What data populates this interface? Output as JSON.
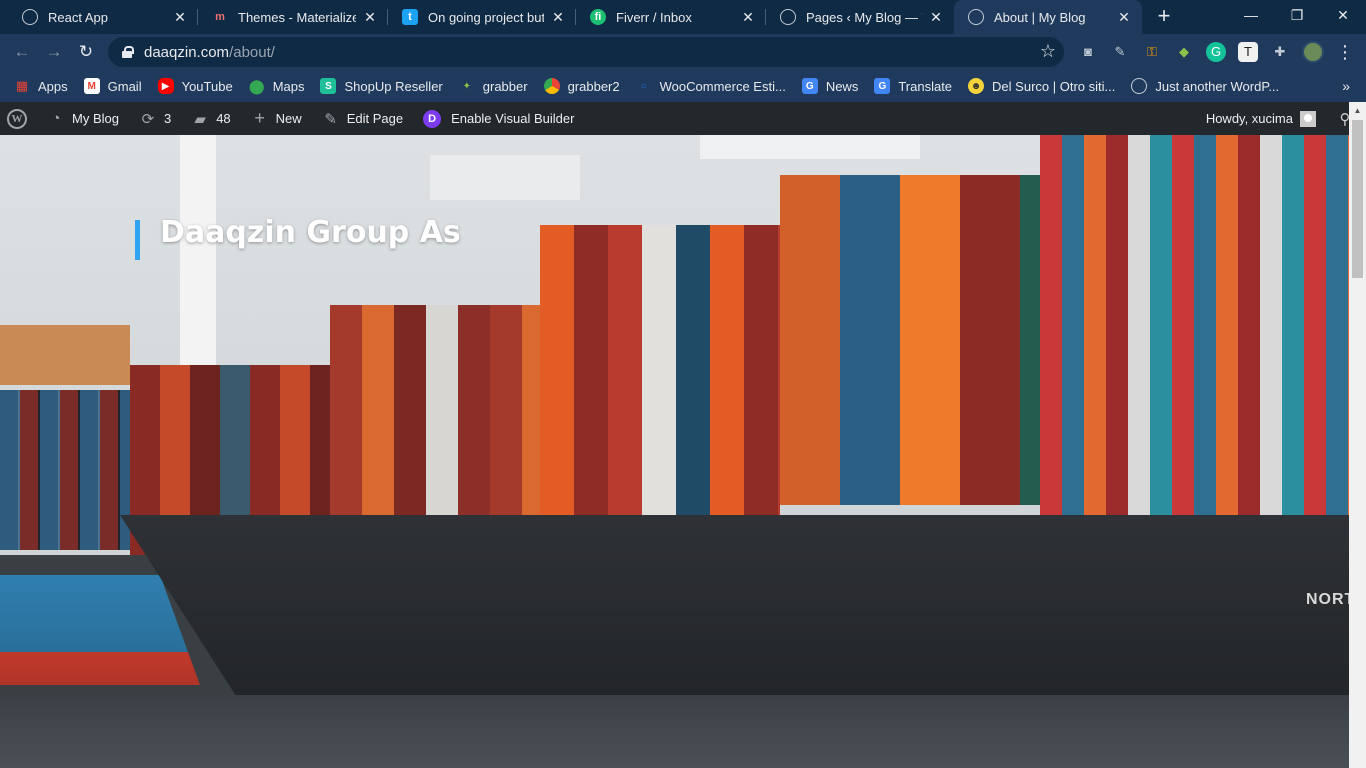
{
  "browser": {
    "tabs": [
      {
        "title": "React App",
        "favicon": "globe-icon",
        "active": false
      },
      {
        "title": "Themes - Materialize",
        "favicon": "materialize-icon",
        "active": false
      },
      {
        "title": "On going project but bu",
        "favicon": "twitter-icon",
        "active": false
      },
      {
        "title": "Fiverr / Inbox",
        "favicon": "fiverr-icon",
        "active": false
      },
      {
        "title": "Pages ‹ My Blog — Wor",
        "favicon": "globe-icon",
        "active": false
      },
      {
        "title": "About | My Blog",
        "favicon": "globe-icon",
        "active": true
      }
    ],
    "new_tab": "+",
    "window_controls": {
      "minimize": "—",
      "restore": "❐",
      "close": "✕"
    },
    "url_host": "daaqzin.com",
    "url_path": "/about/",
    "bookmarks": [
      {
        "label": "Apps",
        "icon": "apps-grid-icon",
        "color": "#ea4335"
      },
      {
        "label": "Gmail",
        "icon": "gmail-icon",
        "color": "#ea4335"
      },
      {
        "label": "YouTube",
        "icon": "youtube-icon",
        "color": "#ff0000"
      },
      {
        "label": "Maps",
        "icon": "maps-icon",
        "color": "#34a853"
      },
      {
        "label": "ShopUp Reseller",
        "icon": "shopup-icon",
        "color": "#1fbf9a"
      },
      {
        "label": "grabber",
        "icon": "grabber-icon",
        "color": "#8bc34a"
      },
      {
        "label": "grabber2",
        "icon": "chrome-icon",
        "color": "#fbbc05"
      },
      {
        "label": "WooCommerce Esti...",
        "icon": "woocommerce-icon",
        "color": "#1a73e8"
      },
      {
        "label": "News",
        "icon": "news-icon",
        "color": "#4285f4"
      },
      {
        "label": "Translate",
        "icon": "translate-icon",
        "color": "#4285f4"
      },
      {
        "label": "Del Surco | Otro siti...",
        "icon": "delsurco-icon",
        "color": "#f5d33a"
      },
      {
        "label": "Just another WordP...",
        "icon": "globe-icon",
        "color": "#c3ccd6"
      }
    ],
    "bookmarks_more": "»"
  },
  "adminbar": {
    "site_name": "My Blog",
    "updates_count": "3",
    "comments_count": "48",
    "new_label": "New",
    "edit_label": "Edit Page",
    "builder_label": "Enable Visual Builder",
    "howdy": "Howdy, xucima"
  },
  "page": {
    "heading": "Daaqzin Group As",
    "hull_text": "NORT",
    "accent_color": "#2ea3f2"
  }
}
